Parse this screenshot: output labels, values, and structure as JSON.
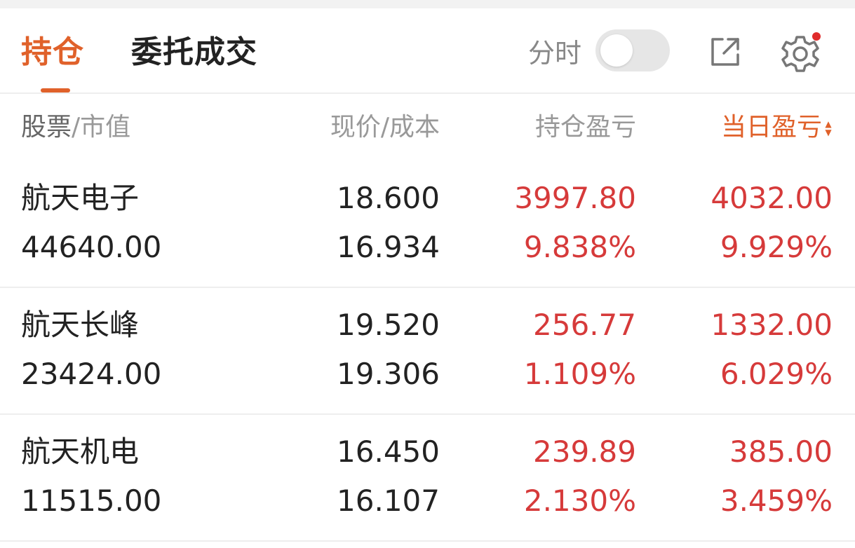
{
  "tabs": {
    "positions": "持仓",
    "orders": "委托成交"
  },
  "controls": {
    "timeshare_label": "分时",
    "timeshare_toggle_on": false,
    "settings_has_notification": true
  },
  "columns": {
    "stock": "股票",
    "market_value": "/市值",
    "price_cost": "现价/成本",
    "position_pl": "持仓盈亏",
    "daily_pl": "当日盈亏"
  },
  "colors": {
    "accent": "#e0612a",
    "profit": "#d63a3a"
  },
  "holdings": [
    {
      "name": "航天电子",
      "market_value": "44640.00",
      "price": "18.600",
      "cost": "16.934",
      "position_pl": "3997.80",
      "position_pl_pct": "9.838%",
      "daily_pl": "4032.00",
      "daily_pl_pct": "9.929%"
    },
    {
      "name": "航天长峰",
      "market_value": "23424.00",
      "price": "19.520",
      "cost": "19.306",
      "position_pl": "256.77",
      "position_pl_pct": "1.109%",
      "daily_pl": "1332.00",
      "daily_pl_pct": "6.029%"
    },
    {
      "name": "航天机电",
      "market_value": "11515.00",
      "price": "16.450",
      "cost": "16.107",
      "position_pl": "239.89",
      "position_pl_pct": "2.130%",
      "daily_pl": "385.00",
      "daily_pl_pct": "3.459%"
    }
  ]
}
